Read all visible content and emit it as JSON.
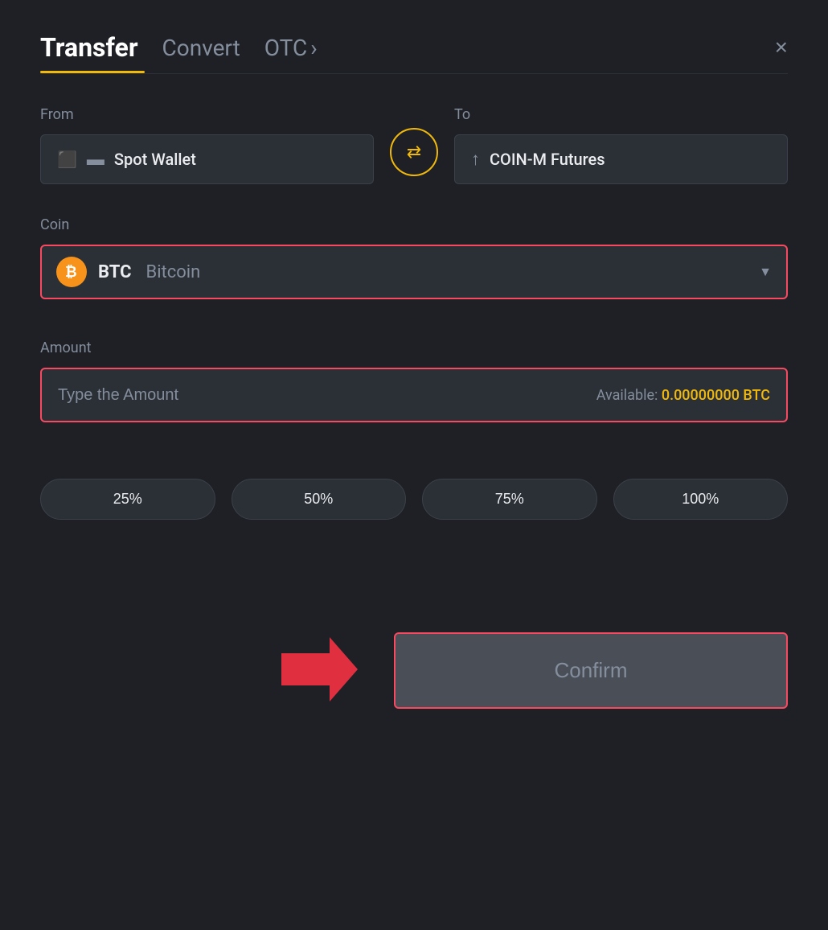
{
  "header": {
    "tab_transfer": "Transfer",
    "tab_convert": "Convert",
    "tab_otc": "OTC",
    "tab_otc_chevron": "›",
    "close_label": "×"
  },
  "from_section": {
    "label": "From",
    "wallet_icon": "🪙",
    "wallet_name": "Spot Wallet"
  },
  "to_section": {
    "label": "To",
    "wallet_icon": "↑",
    "wallet_name": "COIN-M Futures"
  },
  "coin_section": {
    "label": "Coin",
    "coin_symbol": "BTC",
    "coin_name": "Bitcoin",
    "coin_icon": "₿"
  },
  "amount_section": {
    "label": "Amount",
    "placeholder": "Type the Amount",
    "available_label": "Available:",
    "available_amount": "0.00000000 BTC"
  },
  "percentage_buttons": [
    {
      "label": "25%"
    },
    {
      "label": "50%"
    },
    {
      "label": "75%"
    },
    {
      "label": "100%"
    }
  ],
  "confirm_button": {
    "label": "Confirm"
  }
}
